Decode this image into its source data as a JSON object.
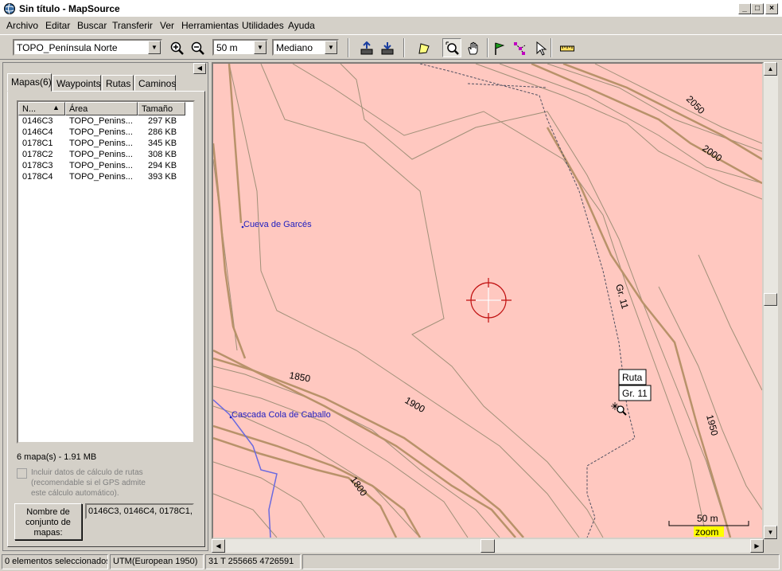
{
  "window": {
    "title": "Sin título - MapSource"
  },
  "menu": [
    "Archivo",
    "Editar",
    "Buscar",
    "Transferir",
    "Ver",
    "Herramientas",
    "Utilidades",
    "Ayuda"
  ],
  "toolbar": {
    "product_select": "TOPO_Península Norte",
    "zoom_select": "50 m",
    "detail_select": "Mediano"
  },
  "tabs": [
    "Mapas(6)",
    "Waypoints",
    "Rutas",
    "Caminos"
  ],
  "maps_list": {
    "columns": [
      "N...",
      "Área",
      "Tamaño"
    ],
    "rows": [
      {
        "name": "0146C3",
        "area": "TOPO_Penins...",
        "size": "297 KB"
      },
      {
        "name": "0146C4",
        "area": "TOPO_Penins...",
        "size": "286 KB"
      },
      {
        "name": "0178C1",
        "area": "TOPO_Penins...",
        "size": "345 KB"
      },
      {
        "name": "0178C2",
        "area": "TOPO_Penins...",
        "size": "308 KB"
      },
      {
        "name": "0178C3",
        "area": "TOPO_Penins...",
        "size": "294 KB"
      },
      {
        "name": "0178C4",
        "area": "TOPO_Penins...",
        "size": "393 KB"
      }
    ]
  },
  "summary": "6 mapa(s) - 1.91 MB",
  "routing_checkbox": "Incluir datos de cálculo de rutas (recomendable si el GPS admite este cálculo automático).",
  "mapset": {
    "button_label": "Nombre de conjunto de mapas:",
    "value": "0146C3, 0146C4, 0178C1, 0"
  },
  "map": {
    "contours": [
      "2050",
      "2000",
      "1950",
      "1900",
      "1850",
      "1800"
    ],
    "pois": [
      "Cueva de Garcés",
      "Cascada Cola de Caballo"
    ],
    "trail_label": "Gr. 11",
    "tooltip": {
      "line1": "Ruta",
      "line2": "Gr. 11"
    },
    "scale_label": "50 m",
    "zoom_label": "zoom",
    "colors": {
      "terrain": "#ffc8c0",
      "contour_major": "#b8926a",
      "contour_minor": "#a09078",
      "water": "#6a6ae0"
    }
  },
  "status": {
    "selection": "0 elementos seleccionados",
    "datum": "UTM(European 1950)",
    "coords": "31 T 255665 4726591"
  }
}
